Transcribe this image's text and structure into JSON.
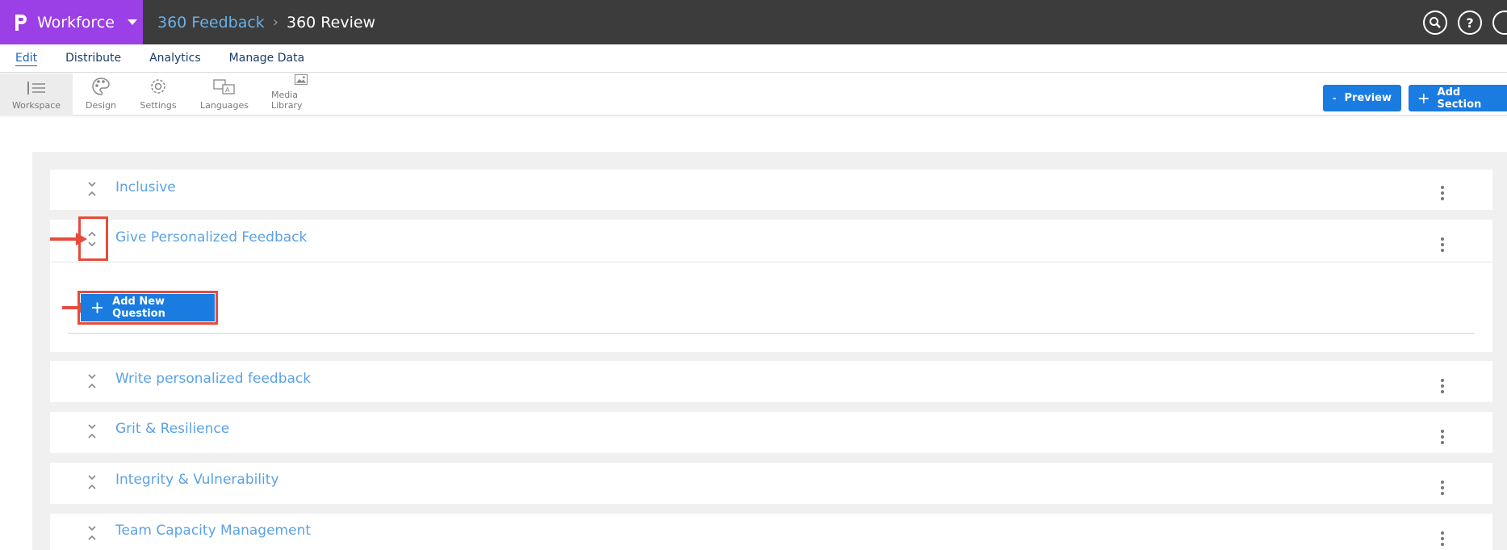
{
  "app": {
    "product_name": "Workforce"
  },
  "breadcrumb": [
    "360 Feedback",
    "360 Review"
  ],
  "tabs": [
    "Edit",
    "Distribute",
    "Analytics",
    "Manage Data"
  ],
  "toolbar": {
    "tools": [
      "Workspace",
      "Design",
      "Settings",
      "Languages",
      "Media Library"
    ],
    "preview_label": "Preview",
    "add_section_label": "Add Section"
  },
  "sections": [
    {
      "title": "Inclusive"
    },
    {
      "title": "Give Personalized Feedback",
      "expanded": true,
      "add_question_label": "Add New Question"
    },
    {
      "title": "Write personalized feedback"
    },
    {
      "title": "Grit & Resilience"
    },
    {
      "title": "Integrity & Vulnerability"
    },
    {
      "title": "Team Capacity Management"
    }
  ],
  "colors": {
    "product": "#9b3fe6",
    "topbar": "#3c3c3c",
    "accent": "#1a7be0",
    "highlight": "#e64b3c",
    "section_title": "#5aa2e6"
  }
}
